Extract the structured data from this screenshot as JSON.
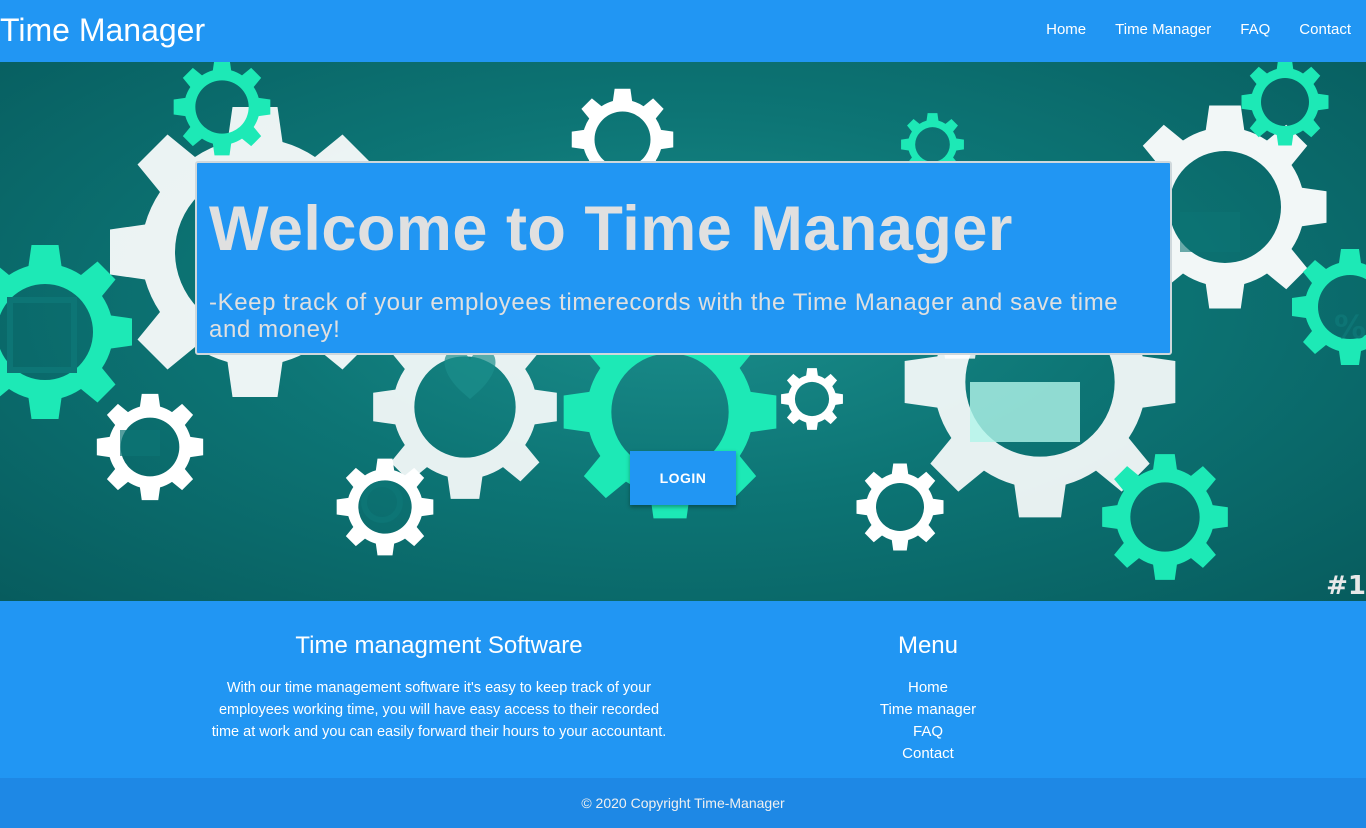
{
  "navbar": {
    "brand": "Time Manager",
    "links": [
      "Home",
      "Time Manager",
      "FAQ",
      "Contact"
    ]
  },
  "hero": {
    "title": "Welcome to Time Manager",
    "subtitle": "-Keep track of your employees timerecords with the Time Manager and save time and money!",
    "login_label": "LOGIN",
    "stock_number": "#1"
  },
  "footer": {
    "about_title": "Time managment Software",
    "about_text": "With our time management software it's easy to keep track of your employees working time, you will have easy access to their recorded time at work and you can easily forward their hours to your accountant.",
    "menu_title": "Menu",
    "menu_items": [
      "Home",
      "Time manager",
      "FAQ",
      "Contact"
    ]
  },
  "copyright": "© 2020 Copyright Time-Manager",
  "colors": {
    "primary": "#2196f3",
    "footer_bottom": "#1e88e5",
    "hero_teal": "#0d7575",
    "gear_cyan": "#1de9b6",
    "gear_white": "#ffffff"
  }
}
